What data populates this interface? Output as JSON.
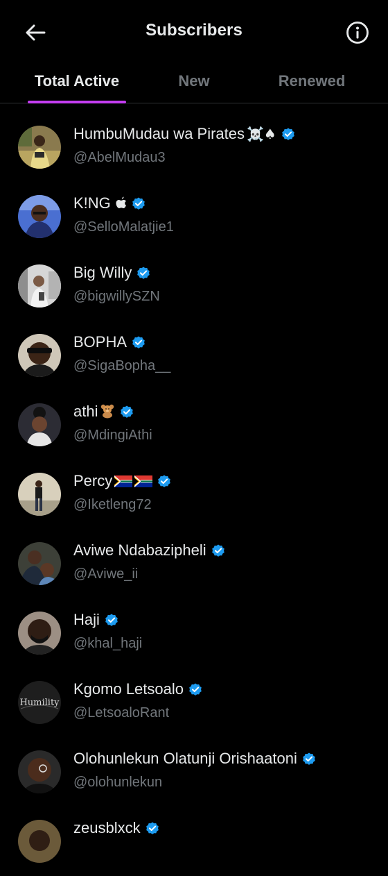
{
  "header": {
    "title": "Subscribers"
  },
  "tabs": [
    {
      "label": "Total Active",
      "active": true
    },
    {
      "label": "New",
      "active": false
    },
    {
      "label": "Renewed",
      "active": false
    }
  ],
  "colors": {
    "background": "#000000",
    "text_primary": "#e7e9ea",
    "text_secondary": "#71767b",
    "tab_indicator": "#c43df0",
    "verified_badge": "#1d9bf0"
  },
  "subscribers": [
    {
      "name": "HumbuMudau wa Pirates",
      "emoji": "☠️♠",
      "handle": "@AbelMudau3",
      "verified": true
    },
    {
      "name": "K!NG",
      "emoji": "",
      "handle": "@SelloMalatjie1",
      "verified": true,
      "icon": "apple-logo-icon"
    },
    {
      "name": "Big Willy",
      "emoji": "",
      "handle": "@bigwillySZN",
      "verified": true
    },
    {
      "name": "BOPHA",
      "emoji": "",
      "handle": "@SigaBopha__",
      "verified": true
    },
    {
      "name": "athi",
      "emoji": "🧸",
      "handle": "@MdingiAthi",
      "verified": true
    },
    {
      "name": "Percy",
      "emoji": "",
      "handle": "@Iketleng72",
      "verified": true,
      "icon": "south-africa-flag-icon"
    },
    {
      "name": "Aviwe Ndabazipheli",
      "emoji": "",
      "handle": "@Aviwe_ii",
      "verified": true
    },
    {
      "name": "Haji",
      "emoji": "",
      "handle": "@khal_haji",
      "verified": true
    },
    {
      "name": "Kgomo Letsoalo",
      "emoji": "",
      "handle": "@LetsoaloRant",
      "verified": true,
      "avatar_text": "Humility"
    },
    {
      "name": "Olohunlekun Olatunji Orishaatoni",
      "emoji": "",
      "handle": "@olohunlekun",
      "verified": true
    },
    {
      "name": "zeusblxck",
      "emoji": "",
      "handle": "",
      "verified": true
    }
  ]
}
